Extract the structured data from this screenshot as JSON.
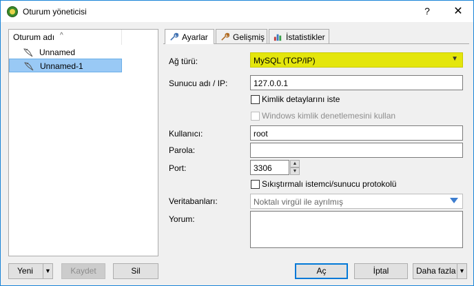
{
  "window": {
    "title": "Oturum yöneticisi",
    "help_label": "?",
    "close_label": "✕"
  },
  "tree": {
    "header": "Oturum adı",
    "sort_indicator": "^",
    "items": [
      {
        "label": "Unnamed"
      },
      {
        "label": "Unnamed-1",
        "selected": true
      }
    ]
  },
  "tabs": [
    {
      "label": "Ayarlar",
      "icon": "wrench-icon",
      "active": true
    },
    {
      "label": "Gelişmiş",
      "icon": "wrench-icon"
    },
    {
      "label": "İstatistikler",
      "icon": "bar-chart-icon"
    }
  ],
  "form": {
    "network_type_label": "Ağ türü:",
    "network_type_value": "MySQL (TCP/IP)",
    "host_label": "Sunucu adı / IP:",
    "host_value": "127.0.0.1",
    "prompt_credentials_label": "Kimlik detaylarını iste",
    "windows_auth_label": "Windows kimlik denetlemesini kullan",
    "user_label": "Kullanıcı:",
    "user_value": "root",
    "password_label": "Parola:",
    "password_value": "",
    "port_label": "Port:",
    "port_value": "3306",
    "compression_label": "Sıkıştırmalı istemci/sunucu protokolü",
    "databases_label": "Veritabanları:",
    "databases_placeholder": "Noktalı virgül ile ayrılmış",
    "comment_label": "Yorum:",
    "comment_value": ""
  },
  "buttons": {
    "new": "Yeni",
    "save": "Kaydet",
    "delete": "Sil",
    "open": "Aç",
    "cancel": "İptal",
    "more": "Daha fazla"
  },
  "colors": {
    "highlight": "#e4e60c",
    "selection": "#99c9f5",
    "accent": "#0078d7"
  }
}
